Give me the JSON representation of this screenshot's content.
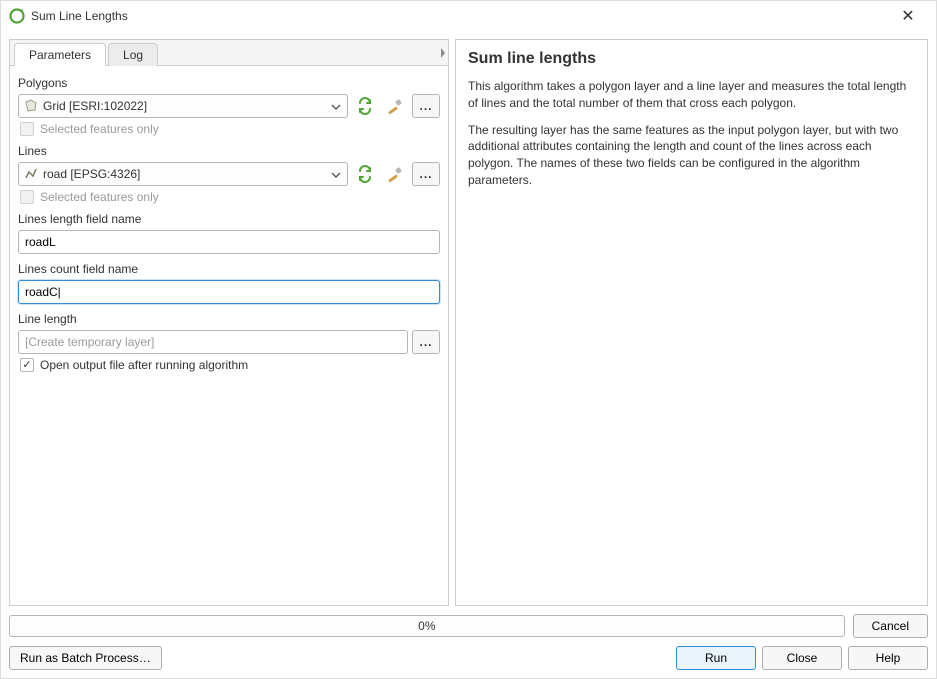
{
  "window": {
    "title": "Sum Line Lengths"
  },
  "tabs": {
    "parameters": "Parameters",
    "log": "Log"
  },
  "labels": {
    "polygons": "Polygons",
    "selected_only": "Selected features only",
    "lines": "Lines",
    "length_field": "Lines length field name",
    "count_field": "Lines count field name",
    "line_length_output": "Line length",
    "open_output": "Open output file after running algorithm"
  },
  "values": {
    "polygons_layer": "Grid [ESRI:102022]",
    "lines_layer": "road [EPSG:4326]",
    "length_field": "roadL",
    "count_field": "roadC|",
    "output_placeholder": "[Create temporary layer]"
  },
  "help": {
    "title": "Sum line lengths",
    "p1": "This algorithm takes a polygon layer and a line layer and measures the total length of lines and the total number of them that cross each polygon.",
    "p2": "The resulting layer has the same features as the input polygon layer, but with two additional attributes containing the length and count of the lines across each polygon. The names of these two fields can be configured in the algorithm parameters."
  },
  "progress": {
    "label": "0%"
  },
  "buttons": {
    "cancel": "Cancel",
    "batch": "Run as Batch Process…",
    "run": "Run",
    "close": "Close",
    "help_btn": "Help",
    "more": "..."
  }
}
